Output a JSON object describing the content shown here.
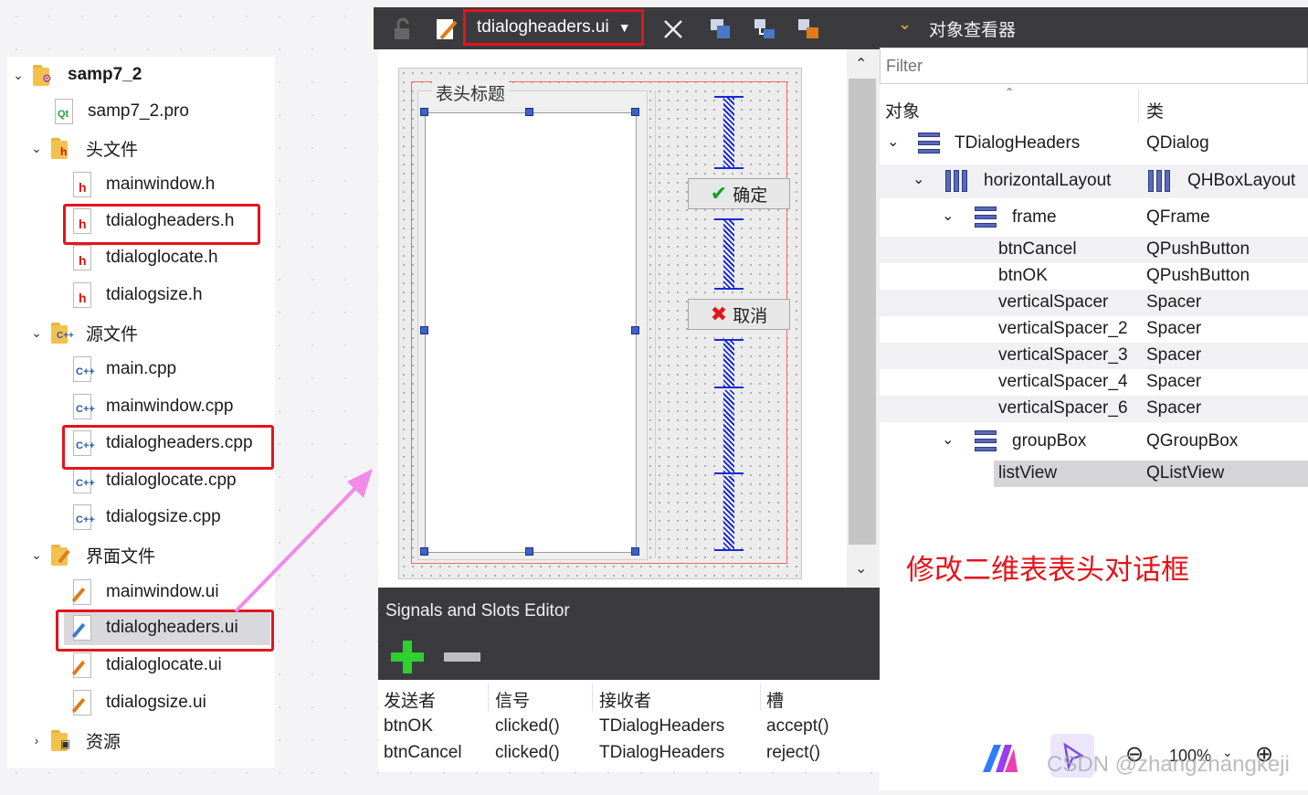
{
  "project_tree": {
    "root": "samp7_2",
    "pro_file": "samp7_2.pro",
    "headers_folder": "头文件",
    "headers": [
      "mainwindow.h",
      "tdialogheaders.h",
      "tdialoglocate.h",
      "tdialogsize.h"
    ],
    "sources_folder": "源文件",
    "sources": [
      "main.cpp",
      "mainwindow.cpp",
      "tdialogheaders.cpp",
      "tdialoglocate.cpp",
      "tdialogsize.cpp"
    ],
    "forms_folder": "界面文件",
    "forms": [
      "mainwindow.ui",
      "tdialogheaders.ui",
      "tdialoglocate.ui",
      "tdialogsize.ui"
    ],
    "resources_folder": "资源"
  },
  "designer": {
    "open_file": "tdialogheaders.ui",
    "group_title": "表头标题",
    "ok_label": "确定",
    "cancel_label": "取消"
  },
  "signals_slots": {
    "title": "Signals and Slots Editor",
    "columns": [
      "发送者",
      "信号",
      "接收者",
      "槽"
    ],
    "rows": [
      [
        "btnOK",
        "clicked()",
        "TDialogHeaders",
        "accept()"
      ],
      [
        "btnCancel",
        "clicked()",
        "TDialogHeaders",
        "reject()"
      ]
    ]
  },
  "inspector": {
    "title": "对象查看器",
    "filter_placeholder": "Filter",
    "col_object": "对象",
    "col_class": "类",
    "rows": [
      {
        "name": "TDialogHeaders",
        "cls": "QDialog"
      },
      {
        "name": "horizontalLayout",
        "cls": "QHBoxLayout"
      },
      {
        "name": "frame",
        "cls": "QFrame"
      },
      {
        "name": "btnCancel",
        "cls": "QPushButton"
      },
      {
        "name": "btnOK",
        "cls": "QPushButton"
      },
      {
        "name": "verticalSpacer",
        "cls": "Spacer"
      },
      {
        "name": "verticalSpacer_2",
        "cls": "Spacer"
      },
      {
        "name": "verticalSpacer_3",
        "cls": "Spacer"
      },
      {
        "name": "verticalSpacer_4",
        "cls": "Spacer"
      },
      {
        "name": "verticalSpacer_6",
        "cls": "Spacer"
      },
      {
        "name": "groupBox",
        "cls": "QGroupBox"
      },
      {
        "name": "listView",
        "cls": "QListView"
      }
    ]
  },
  "caption": "修改二维表表头对话框",
  "zoom": "100%",
  "watermark": "CSDN @zhangzhangkeji",
  "colors": {
    "highlight": "#e4141b",
    "dark_panel": "#3b3b3f",
    "spacer": "#1a2ad6",
    "arrow": "#f08be8"
  }
}
